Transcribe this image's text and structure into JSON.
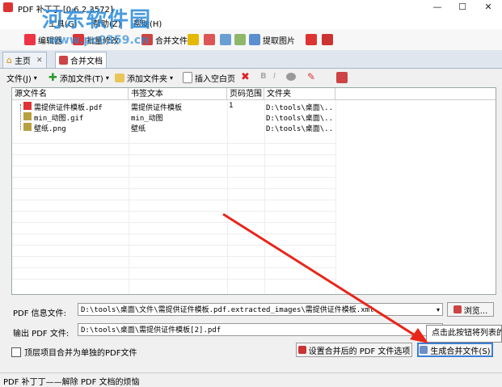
{
  "window": {
    "title": "PDF 补丁丁 [0.6.2.3572]",
    "minimize": "—",
    "maximize": "☐",
    "close": "✕"
  },
  "watermark": {
    "text": "河东软件园",
    "url": "www.pc0359.cn"
  },
  "menu": {
    "items": [
      "工具(G)",
      "帮助(Z)",
      "帮助(H)"
    ]
  },
  "toolbar": {
    "items": [
      {
        "label": "编辑器",
        "icon": "editor-icon"
      },
      {
        "label": "批量修改",
        "icon": "batch-icon"
      },
      {
        "label": "合并文件",
        "icon": "merge-icon"
      },
      {
        "label": "提取图片",
        "icon": "extract-image-icon"
      }
    ]
  },
  "tabs": [
    {
      "label": "主页",
      "close": "✕"
    },
    {
      "label": "合并文档",
      "close": ""
    }
  ],
  "merge_toolbar": {
    "file_menu": "文件(J)",
    "add_file": "添加文件(T)",
    "add_folder": "添加文件夹",
    "insert_blank": "插入空白页"
  },
  "grid": {
    "columns": [
      "源文件名",
      "书签文本",
      "页码范围",
      "文件夹"
    ],
    "rows": [
      {
        "name": "需提供证件模板.pdf",
        "bookmark": "需提供证件模板",
        "pages": "1",
        "folder": "D:\\tools\\桌面\\..."
      },
      {
        "name": "min_动图.gif",
        "bookmark": "min_动图",
        "pages": "",
        "folder": "D:\\tools\\桌面\\..."
      },
      {
        "name": "壁纸.png",
        "bookmark": "壁纸",
        "pages": "",
        "folder": "D:\\tools\\桌面\\..."
      }
    ]
  },
  "info_file": {
    "label": "PDF 信息文件:",
    "value": "D:\\tools\\桌面\\文件\\需提供证件模板.pdf.extracted_images\\需提供证件模板.xml",
    "browse": "浏览..."
  },
  "output_file": {
    "label": "输出 PDF 文件:",
    "value": "D:\\tools\\桌面\\需提供证件模板[2].pdf"
  },
  "options": {
    "checkbox_label": "顶层项目合并为单独的PDF文件",
    "settings_button": "设置合并后的 PDF 文件选项",
    "merge_button": "生成合并文件(S)"
  },
  "tooltip": "点击此按钮将列表的",
  "status": "PDF 补丁丁——解除 PDF 文档的烦恼",
  "colors": {
    "accent": "#2a8ad8",
    "arrow": "#e8261a"
  }
}
